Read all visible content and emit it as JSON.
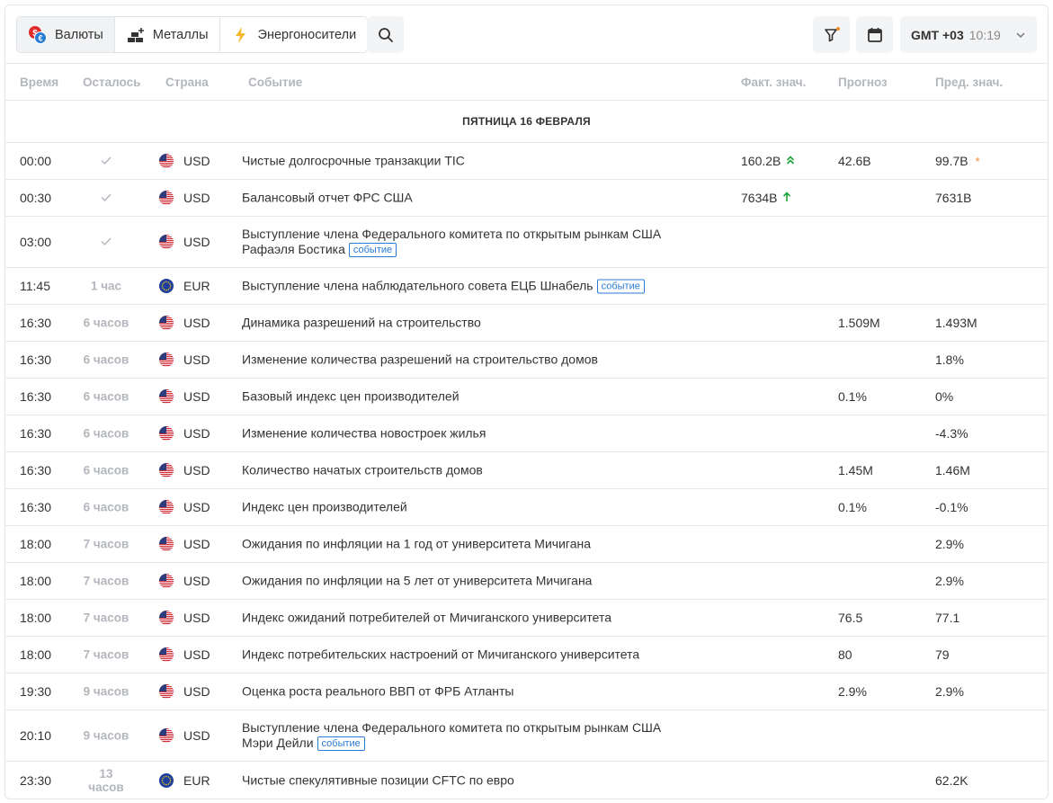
{
  "toolbar": {
    "tabs": [
      {
        "label": "Валюты",
        "icon": "currency-icon",
        "active": true
      },
      {
        "label": "Металлы",
        "icon": "metals-icon",
        "active": false
      },
      {
        "label": "Энергоносители",
        "icon": "lightning-icon",
        "active": false
      }
    ],
    "timezone": {
      "label": "GMT +03",
      "time": "10:19"
    }
  },
  "columns": {
    "time": "Время",
    "left": "Осталось",
    "country": "Страна",
    "event": "Событие",
    "actual": "Факт. знач.",
    "forecast": "Прогноз",
    "previous": "Пред. знач."
  },
  "day_header": "ПЯТНИЦА 16 ФЕВРАЛЯ",
  "badge_label": "событие",
  "rows": [
    {
      "time": "00:00",
      "left": "✓",
      "currency": "USD",
      "event": "Чистые долгосрочные транзакции TIC",
      "badge": false,
      "actual": "160.2B",
      "actual_trend": "double-up",
      "forecast": "42.6B",
      "previous": "99.7B",
      "revised": true
    },
    {
      "time": "00:30",
      "left": "✓",
      "currency": "USD",
      "event": "Балансовый отчет ФРС США",
      "badge": false,
      "actual": "7634B",
      "actual_trend": "up",
      "forecast": "",
      "previous": "7631B",
      "revised": false
    },
    {
      "time": "03:00",
      "left": "✓",
      "currency": "USD",
      "event": "Выступление члена Федерального комитета по открытым рынкам США",
      "event_line2": "Рафаэля Бостика",
      "badge": true,
      "actual": "",
      "forecast": "",
      "previous": ""
    },
    {
      "time": "11:45",
      "left": "1 час",
      "currency": "EUR",
      "event": "Выступление члена наблюдательного совета ЕЦБ Шнабель",
      "badge": true,
      "actual": "",
      "forecast": "",
      "previous": ""
    },
    {
      "time": "16:30",
      "left": "6 часов",
      "currency": "USD",
      "event": "Динамика разрешений на строительство",
      "badge": false,
      "actual": "",
      "forecast": "1.509M",
      "previous": "1.493M"
    },
    {
      "time": "16:30",
      "left": "6 часов",
      "currency": "USD",
      "event": "Изменение количества разрешений на строительство домов",
      "badge": false,
      "actual": "",
      "forecast": "",
      "previous": "1.8%"
    },
    {
      "time": "16:30",
      "left": "6 часов",
      "currency": "USD",
      "event": "Базовый индекс цен производителей",
      "badge": false,
      "actual": "",
      "forecast": "0.1%",
      "previous": "0%"
    },
    {
      "time": "16:30",
      "left": "6 часов",
      "currency": "USD",
      "event": "Изменение количества новостроек жилья",
      "badge": false,
      "actual": "",
      "forecast": "",
      "previous": "-4.3%"
    },
    {
      "time": "16:30",
      "left": "6 часов",
      "currency": "USD",
      "event": "Количество начатых строительств домов",
      "badge": false,
      "actual": "",
      "forecast": "1.45M",
      "previous": "1.46M"
    },
    {
      "time": "16:30",
      "left": "6 часов",
      "currency": "USD",
      "event": "Индекс цен производителей",
      "badge": false,
      "actual": "",
      "forecast": "0.1%",
      "previous": "-0.1%"
    },
    {
      "time": "18:00",
      "left": "7 часов",
      "currency": "USD",
      "event": "Ожидания по инфляции на 1 год от университета Мичигана",
      "badge": false,
      "actual": "",
      "forecast": "",
      "previous": "2.9%"
    },
    {
      "time": "18:00",
      "left": "7 часов",
      "currency": "USD",
      "event": "Ожидания по инфляции на 5 лет от университета Мичигана",
      "badge": false,
      "actual": "",
      "forecast": "",
      "previous": "2.9%"
    },
    {
      "time": "18:00",
      "left": "7 часов",
      "currency": "USD",
      "event": "Индекс ожиданий потребителей от Мичиганского университета",
      "badge": false,
      "actual": "",
      "forecast": "76.5",
      "previous": "77.1"
    },
    {
      "time": "18:00",
      "left": "7 часов",
      "currency": "USD",
      "event": "Индекс потребительских настроений от Мичиганского университета",
      "badge": false,
      "actual": "",
      "forecast": "80",
      "previous": "79"
    },
    {
      "time": "19:30",
      "left": "9 часов",
      "currency": "USD",
      "event": "Оценка роста реального ВВП от ФРБ Атланты",
      "badge": false,
      "actual": "",
      "forecast": "2.9%",
      "previous": "2.9%"
    },
    {
      "time": "20:10",
      "left": "9 часов",
      "currency": "USD",
      "event": "Выступление члена Федерального комитета по открытым рынкам США",
      "event_line2": "Мэри Дейли",
      "badge": true,
      "actual": "",
      "forecast": "",
      "previous": ""
    },
    {
      "time": "23:30",
      "left": "13 часов",
      "currency": "EUR",
      "event": "Чистые спекулятивные позиции CFTC по евро",
      "badge": false,
      "actual": "",
      "forecast": "",
      "previous": "62.2K"
    }
  ],
  "colors": {
    "positive": "#1fa33b",
    "badge": "#2a7bd4",
    "revised_star": "#f08c2e",
    "filter_dot": "#f08c2e"
  }
}
